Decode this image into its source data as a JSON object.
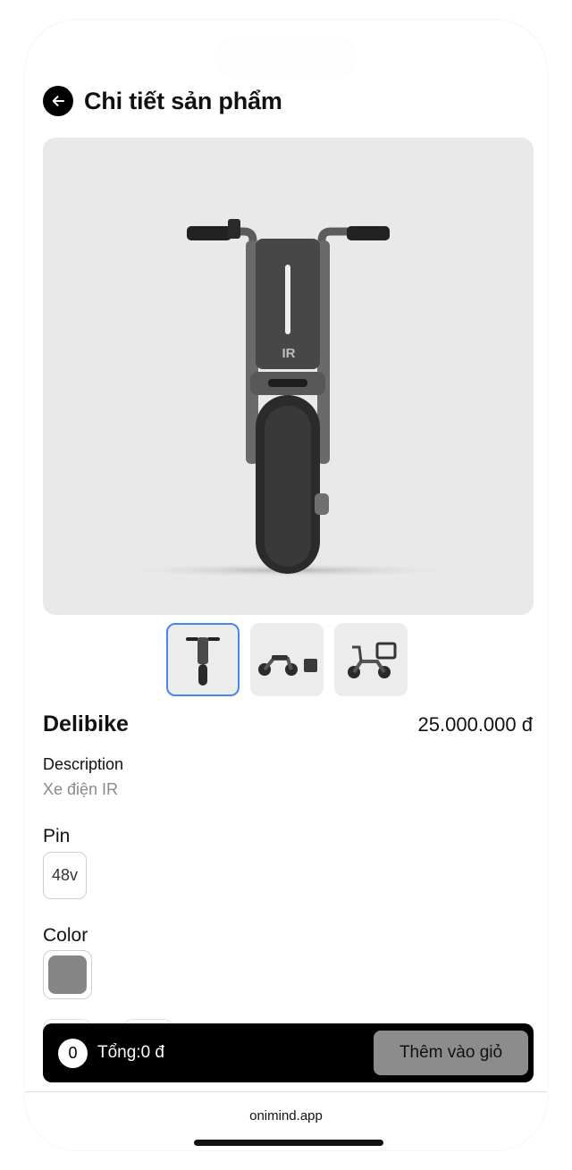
{
  "header": {
    "title": "Chi tiết sản phẩm"
  },
  "gallery": {
    "thumbnails": [
      {
        "alt": "front view",
        "selected": true
      },
      {
        "alt": "side view with box",
        "selected": false
      },
      {
        "alt": "side view with basket",
        "selected": false
      }
    ]
  },
  "product": {
    "name": "Delibike",
    "price": "25.000.000 đ",
    "description_label": "Description",
    "description": "Xe điện IR",
    "hero_badge": "IR"
  },
  "options": {
    "pin_label": "Pin",
    "pin_value": "48v",
    "color_label": "Color",
    "color_value": "#868686"
  },
  "cart": {
    "count": "0",
    "total": "Tổng:0 đ",
    "add_button": "Thêm vào giỏ"
  },
  "footer": {
    "domain": "onimind.app"
  },
  "colors": {
    "accent": "#4a86e8",
    "bar": "#000000",
    "button": "#8c8c8c"
  }
}
